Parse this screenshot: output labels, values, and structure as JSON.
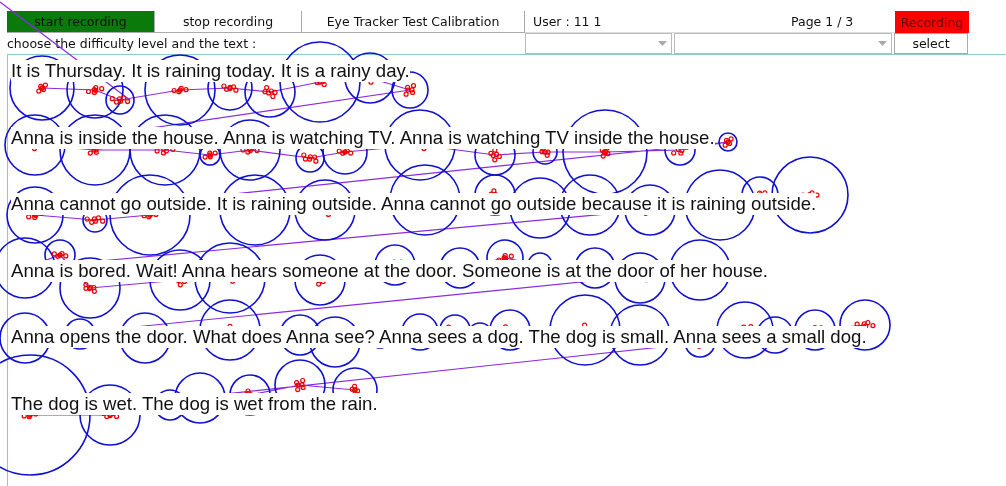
{
  "toolbar": {
    "buttons": [
      {
        "label": "start recording",
        "active": true
      },
      {
        "label": "stop recording",
        "active": false
      },
      {
        "label": "Eye Tracker Test Calibration",
        "active": false
      }
    ],
    "user": "User : 11 1",
    "page": "Page 1 / 3",
    "status": {
      "label": "Recording",
      "on": true
    }
  },
  "selection": {
    "prompt": "choose the difficulty level and the text :",
    "dropdowns": [
      {
        "kind": "combo"
      },
      {
        "kind": "combo"
      }
    ],
    "button": "select"
  },
  "text_lines": [
    "It is Thursday. It is raining today. It is a rainy day.",
    "Anna is inside the house. Anna is watching TV. Anna is watching TV inside the house.",
    "Anna cannot go outside. It is raining outside. Anna cannot go outside because it is raining outside.",
    "Anna is bored. Wait! Anna hears someone at the door. Someone is at the door of her house.",
    "Anna opens the door. What does Anna see? Anna sees a dog. The dog is small. Anna sees a small dog.",
    "The dog is wet. The dog is wet from the rain."
  ]
}
